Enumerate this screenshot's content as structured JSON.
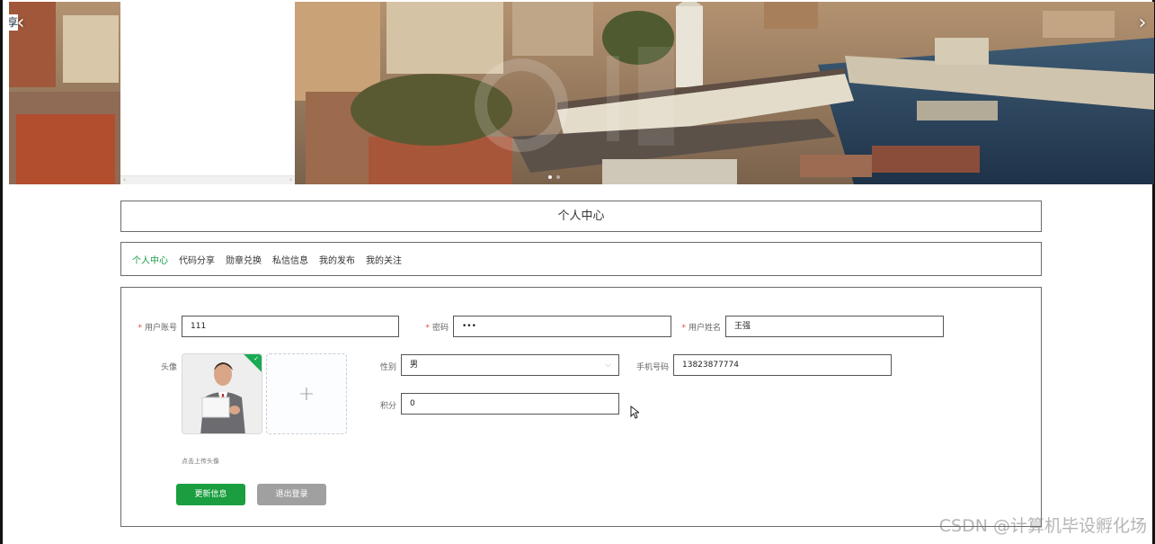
{
  "banner": {
    "prev_icon": "chevron-left-icon",
    "prev_glyph": "‹",
    "next_icon": "chevron-right-icon",
    "next_glyph": "›",
    "edge_glyph": "享",
    "scroll_left_glyph": "‹",
    "scroll_right_glyph": "›"
  },
  "header": {
    "title": "个人中心"
  },
  "tabs": [
    {
      "label": "个人中心",
      "active": true
    },
    {
      "label": "代码分享",
      "active": false
    },
    {
      "label": "勋章兑换",
      "active": false
    },
    {
      "label": "私信信息",
      "active": false
    },
    {
      "label": "我的发布",
      "active": false
    },
    {
      "label": "我的关注",
      "active": false
    }
  ],
  "form": {
    "required_mark": "*",
    "username": {
      "label": "用户账号",
      "value": "111"
    },
    "password": {
      "label": "密码",
      "value": "•••"
    },
    "realname": {
      "label": "用户姓名",
      "value": "王强"
    },
    "avatar": {
      "label": "头像",
      "hint": "点击上传头像",
      "upload_icon": "plus-icon",
      "upload_glyph": "+",
      "check_glyph": "✓"
    },
    "gender": {
      "label": "性别",
      "value": "男",
      "arrow_glyph": "⌵"
    },
    "phone": {
      "label": "手机号码",
      "value": "13823877774"
    },
    "points": {
      "label": "积分",
      "value": "0"
    }
  },
  "buttons": {
    "update": "更新信息",
    "logout": "退出登录"
  },
  "watermark": "CSDN @计算机毕设孵化场",
  "colors": {
    "accent": "#1a9e3f",
    "secondary_button": "#a0a0a0",
    "required": "#e54d42"
  }
}
